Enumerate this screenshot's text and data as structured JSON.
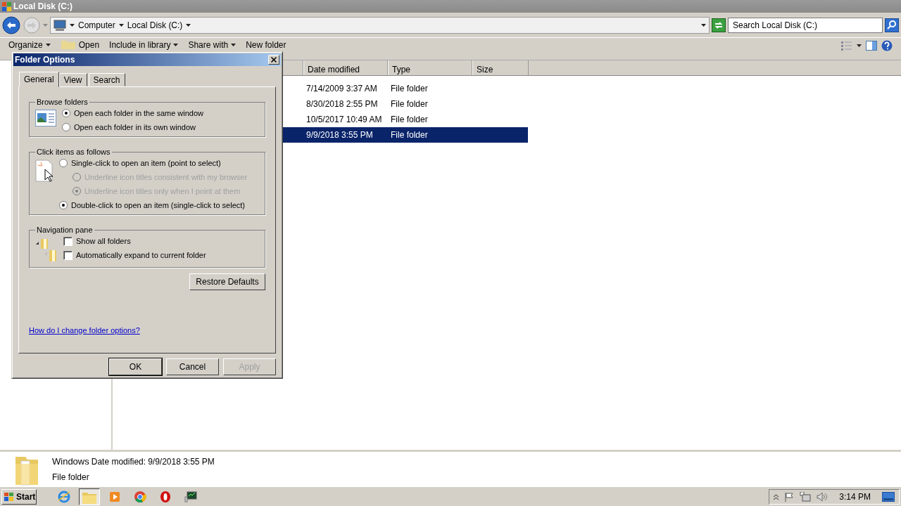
{
  "explorer": {
    "title": "Local Disk (C:)",
    "breadcrumb": [
      "Computer",
      "Local Disk (C:)"
    ],
    "search": {
      "placeholder": "Search Local Disk (C:)"
    },
    "toolbar": [
      {
        "label": "Organize",
        "kind": "menu"
      },
      {
        "label": "Open",
        "kind": "open"
      },
      {
        "label": "Include in library",
        "kind": "menu"
      },
      {
        "label": "Share with",
        "kind": "menu"
      },
      {
        "label": "New folder",
        "kind": "plain"
      }
    ],
    "columns": [
      "Date modified",
      "Type",
      "Size"
    ],
    "rows": [
      {
        "date": "7/14/2009 3:37 AM",
        "type": "File folder",
        "selected": false
      },
      {
        "date": "8/30/2018 2:55 PM",
        "type": "File folder",
        "selected": false
      },
      {
        "date": "10/5/2017 10:49 AM",
        "type": "File folder",
        "selected": false
      },
      {
        "date": "9/9/2018 3:55 PM",
        "type": "File folder",
        "selected": true
      }
    ],
    "details": {
      "name": "Windows",
      "label": "Date modified:",
      "value": "9/9/2018 3:55 PM",
      "type": "File folder"
    }
  },
  "dialog": {
    "title": "Folder Options",
    "tabs": [
      {
        "label": "General",
        "selected": true
      },
      {
        "label": "View",
        "selected": false
      },
      {
        "label": "Search",
        "selected": false
      }
    ],
    "groups": [
      {
        "title": "Browse folders",
        "kind": "radios",
        "items": [
          {
            "label": "Open each folder in the same window",
            "checked": true,
            "disabled": false
          },
          {
            "label": "Open each folder in its own window",
            "checked": false,
            "disabled": false
          }
        ]
      },
      {
        "title": "Click items as follows",
        "kind": "radios",
        "items": [
          {
            "label": "Single-click to open an item (point to select)",
            "checked": false,
            "disabled": false,
            "children": [
              {
                "label": "Underline icon titles consistent with my browser",
                "checked": false,
                "disabled": true
              },
              {
                "label": "Underline icon titles only when I point at them",
                "checked": true,
                "disabled": true
              }
            ]
          },
          {
            "label": "Double-click to open an item (single-click to select)",
            "checked": true,
            "disabled": false
          }
        ]
      },
      {
        "title": "Navigation pane",
        "kind": "checkboxes",
        "items": [
          {
            "label": "Show all folders",
            "checked": false,
            "disabled": false
          },
          {
            "label": "Automatically expand to current folder",
            "checked": false,
            "disabled": false
          }
        ]
      }
    ],
    "restore": "Restore Defaults",
    "help_link": "How do I change folder options?",
    "buttons": [
      {
        "label": "OK",
        "default": true,
        "disabled": false
      },
      {
        "label": "Cancel",
        "default": false,
        "disabled": false
      },
      {
        "label": "Apply",
        "default": false,
        "disabled": true
      }
    ]
  },
  "taskbar": {
    "start": "Start",
    "clock": "3:14 PM",
    "apps": [
      {
        "kind": "ie",
        "active": false
      },
      {
        "kind": "explorer",
        "active": true
      },
      {
        "kind": "media",
        "active": false
      },
      {
        "kind": "chrome",
        "active": false
      },
      {
        "kind": "opera",
        "active": false
      },
      {
        "kind": "monitor",
        "active": false
      }
    ]
  }
}
